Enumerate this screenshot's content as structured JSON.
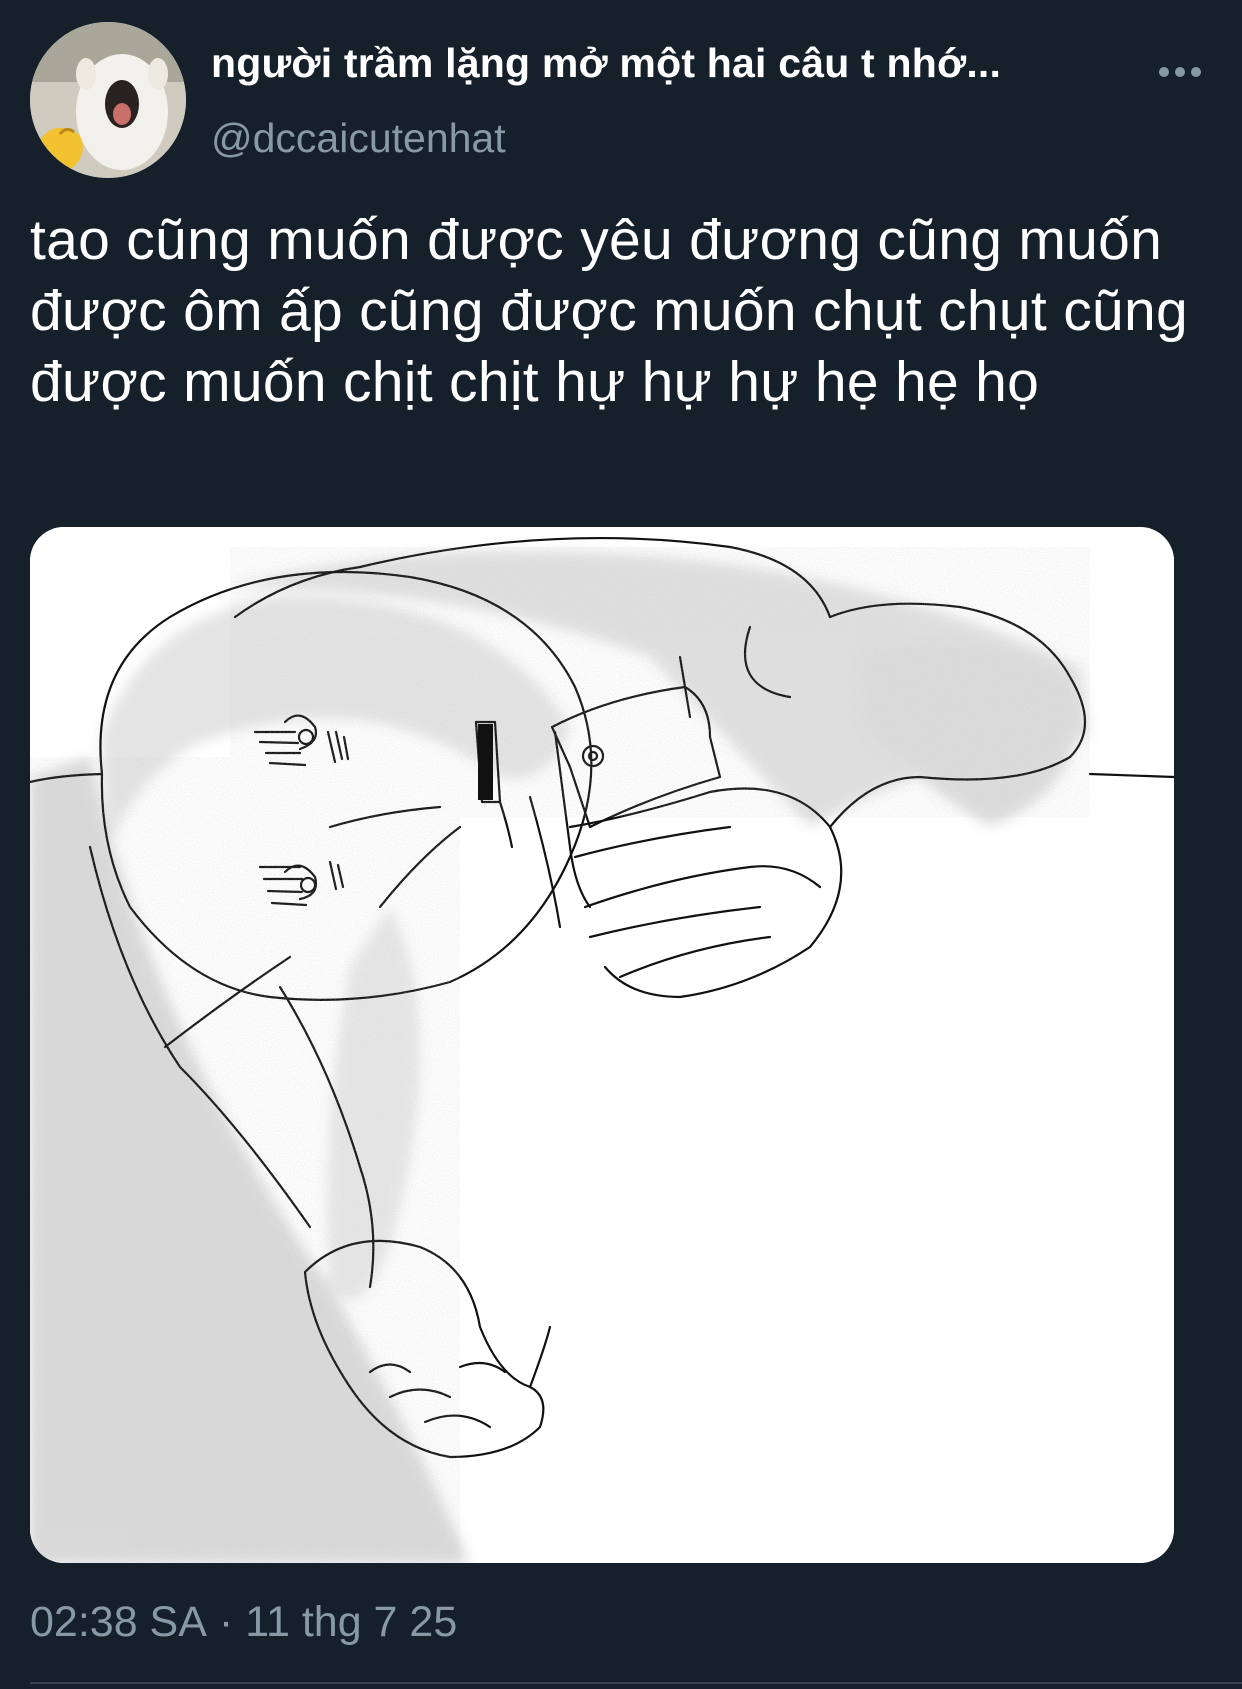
{
  "tweet": {
    "display_name": "người trầm lặng mở một hai câu t nhớ...",
    "handle": "@dccaicutenhat",
    "text": "tao cũng muốn được yêu đương cũng muốn được ôm ấp cũng được muốn chụt chụt cũng được muốn chịt chịt hự hự hự hẹ hẹ họ",
    "timestamp_time": "02:38 SA",
    "timestamp_separator": "·",
    "timestamp_date": "11 thg 7 25"
  },
  "icons": {
    "more": "more-horizontal-icon"
  },
  "colors": {
    "background": "#15202b",
    "primary_text": "#ffffff",
    "secondary_text": "#8899a6",
    "divider": "#38444d",
    "media_background": "#ffffff"
  }
}
